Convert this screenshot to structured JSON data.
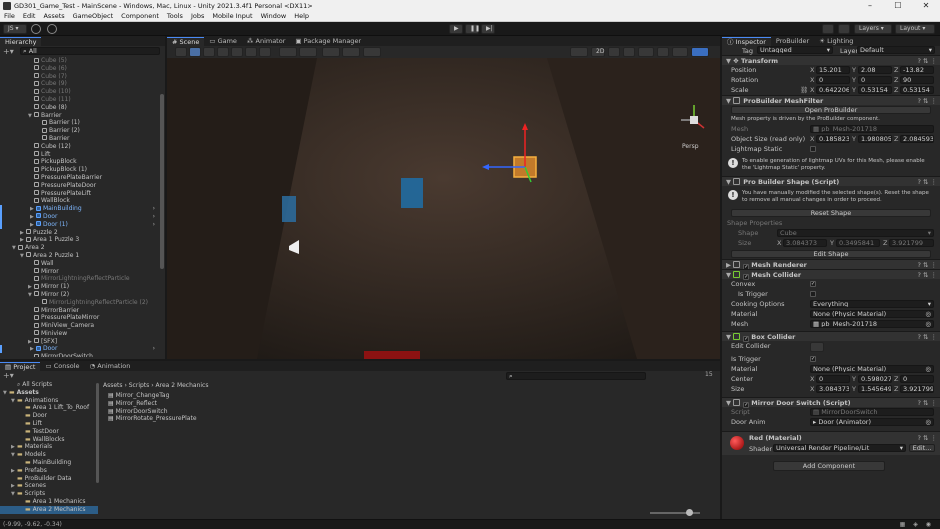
{
  "window": {
    "title": "GD301_Game_Test - MainScene - Windows, Mac, Linux - Unity 2021.3.4f1 Personal <DX11>"
  },
  "menu": [
    "File",
    "Edit",
    "Assets",
    "GameObject",
    "Component",
    "Tools",
    "Jobs",
    "Mobile Input",
    "Window",
    "Help"
  ],
  "toolbar": {
    "account": "JS",
    "layers": "Layers",
    "layout": "Layout"
  },
  "hierarchy": {
    "tab": "Hierarchy",
    "search_placeholder": "All",
    "rows": [
      {
        "label": "Cube (5)",
        "indent": 3,
        "dim": true
      },
      {
        "label": "Cube (6)",
        "indent": 3,
        "dim": true
      },
      {
        "label": "Cube (7)",
        "indent": 3,
        "dim": true
      },
      {
        "label": "Cube (9)",
        "indent": 3,
        "dim": true
      },
      {
        "label": "Cube (10)",
        "indent": 3,
        "dim": true
      },
      {
        "label": "Cube (11)",
        "indent": 3,
        "dim": true
      },
      {
        "label": "Cube (8)",
        "indent": 3
      },
      {
        "label": "Barrier",
        "indent": 3,
        "arrow": "▼"
      },
      {
        "label": "Barrier (1)",
        "indent": 4
      },
      {
        "label": "Barrier (2)",
        "indent": 4
      },
      {
        "label": "Barrier",
        "indent": 4
      },
      {
        "label": "Cube (12)",
        "indent": 3
      },
      {
        "label": "Lift",
        "indent": 3
      },
      {
        "label": "PickupBlock",
        "indent": 3
      },
      {
        "label": "PickupBlock (1)",
        "indent": 3
      },
      {
        "label": "PressurePlateBarrier",
        "indent": 3
      },
      {
        "label": "PressurePlateDoor",
        "indent": 3
      },
      {
        "label": "PressurePlateLift",
        "indent": 3
      },
      {
        "label": "WallBlock",
        "indent": 3
      },
      {
        "label": "MainBuilding",
        "indent": 3,
        "arrow": "▶",
        "blue": true
      },
      {
        "label": "Door",
        "indent": 3,
        "arrow": "▶",
        "blue": true
      },
      {
        "label": "Door (1)",
        "indent": 3,
        "arrow": "▶",
        "blue": true
      },
      {
        "label": "Puzzle 2",
        "indent": 2,
        "arrow": "▶"
      },
      {
        "label": "Area 1 Puzzle 3",
        "indent": 2,
        "arrow": "▶"
      },
      {
        "label": "Area 2",
        "indent": 1,
        "arrow": "▼"
      },
      {
        "label": "Area 2 Puzzle 1",
        "indent": 2,
        "arrow": "▼"
      },
      {
        "label": "Wall",
        "indent": 3
      },
      {
        "label": "Mirror",
        "indent": 3
      },
      {
        "label": "MirrorLightningReflectParticle",
        "indent": 3,
        "dim": true
      },
      {
        "label": "Mirror (1)",
        "indent": 3,
        "arrow": "▶"
      },
      {
        "label": "Mirror (2)",
        "indent": 3,
        "arrow": "▼"
      },
      {
        "label": "MirrorLightningReflectParticle (2)",
        "indent": 4,
        "dim": true
      },
      {
        "label": "MirrorBarrier",
        "indent": 3
      },
      {
        "label": "PressurePlateMirror",
        "indent": 3
      },
      {
        "label": "MiniView_Camera",
        "indent": 3
      },
      {
        "label": "Miniview",
        "indent": 3
      },
      {
        "label": "[SFX]",
        "indent": 3,
        "arrow": "▶"
      },
      {
        "label": "Door",
        "indent": 3,
        "arrow": "▶",
        "blue": true
      },
      {
        "label": "MirrorDoorSwitch",
        "indent": 3
      }
    ]
  },
  "scene": {
    "tabs": [
      "Scene",
      "Game",
      "Animator",
      "Package Manager"
    ],
    "mode_2d": "2D",
    "persp": "Persp"
  },
  "project": {
    "tabs": [
      "Project",
      "Console",
      "Animation"
    ],
    "tree": [
      {
        "label": "All Scripts",
        "indent": 1
      },
      {
        "label": "Assets",
        "indent": 0,
        "arrow": "▼",
        "bold": true
      },
      {
        "label": "Animations",
        "indent": 1,
        "arrow": "▼"
      },
      {
        "label": "Area 1 Lift_To_Roof",
        "indent": 2
      },
      {
        "label": "Door",
        "indent": 2
      },
      {
        "label": "Lift",
        "indent": 2
      },
      {
        "label": "TestDoor",
        "indent": 2
      },
      {
        "label": "WallBlocks",
        "indent": 2
      },
      {
        "label": "Materials",
        "indent": 1,
        "arrow": "▶"
      },
      {
        "label": "Models",
        "indent": 1,
        "arrow": "▼"
      },
      {
        "label": "MainBuilding",
        "indent": 2
      },
      {
        "label": "Prefabs",
        "indent": 1,
        "arrow": "▶"
      },
      {
        "label": "ProBuilder Data",
        "indent": 1
      },
      {
        "label": "Scenes",
        "indent": 1,
        "arrow": "▶"
      },
      {
        "label": "Scripts",
        "indent": 1,
        "arrow": "▼"
      },
      {
        "label": "Area 1 Mechanics",
        "indent": 2
      },
      {
        "label": "Area 2 Mechanics",
        "indent": 2,
        "selected": true
      }
    ],
    "breadcrumb": [
      "Assets",
      "Scripts",
      "Area 2 Mechanics"
    ],
    "files": [
      "Mirror_ChangeTag",
      "Mirror_Reflect",
      "MirrorDoorSwitch",
      "MirrorRotate_PressurePlate"
    ],
    "count": "15"
  },
  "inspector": {
    "tabs": [
      "Inspector",
      "ProBuilder",
      "Lighting"
    ],
    "tag_label": "Tag",
    "tag_value": "Untagged",
    "layer_label": "Layer",
    "layer_value": "Default",
    "transform": {
      "title": "Transform",
      "position_label": "Position",
      "rotation_label": "Rotation",
      "scale_label": "Scale",
      "position": [
        "15.201",
        "2.08",
        "-13.82"
      ],
      "rotation": [
        "0",
        "0",
        "90"
      ],
      "scale": [
        "0.642206",
        "0.53154",
        "0.53154"
      ]
    },
    "meshfilter": {
      "title": "ProBuilder MeshFilter",
      "open_button": "Open ProBuilder",
      "note": "Mesh property is driven by the ProBuilder component.",
      "mesh_label": "Mesh",
      "mesh_value": "pb_Mesh-201718",
      "objsize_label": "Object Size (read only)",
      "objsize": [
        "0.1858238",
        "1.980805",
        "2.084593"
      ],
      "lightmap_label": "Lightmap Static",
      "lightmap_help": "To enable generation of lightmap UVs for this Mesh, please enable the 'Lightmap Static' property."
    },
    "shape": {
      "title": "Pro Builder Shape (Script)",
      "help": "You have manually modified the selected shape(s). Reset the shape to remove all manual changes in order to proceed.",
      "reset_button": "Reset Shape",
      "props_label": "Shape Properties",
      "shape_label": "Shape",
      "shape_value": "Cube",
      "size_label": "Size",
      "size": [
        "3.084373",
        "0.3495841",
        "3.921799"
      ],
      "edit_button": "Edit Shape"
    },
    "renderer": {
      "title": "Mesh Renderer"
    },
    "collider": {
      "title": "Mesh Collider",
      "convex_label": "Convex",
      "trigger_label": "Is Trigger",
      "cooking_label": "Cooking Options",
      "cooking_value": "Everything",
      "material_label": "Material",
      "material_value": "None (Physic Material)",
      "mesh_label": "Mesh",
      "mesh_value": "pb_Mesh-201718"
    },
    "box": {
      "title": "Box Collider",
      "edit_label": "Edit Collider",
      "trigger_label": "Is Trigger",
      "material_label": "Material",
      "material_value": "None (Physic Material)",
      "center_label": "Center",
      "center": [
        "0",
        "0.5980272",
        "0"
      ],
      "size_label": "Size",
      "size": [
        "3.084373",
        "1.545649",
        "3.921799"
      ]
    },
    "switch": {
      "title": "Mirror Door Switch (Script)",
      "script_label": "Script",
      "script_value": "MirrorDoorSwitch",
      "anim_label": "Door Anim",
      "anim_value": "Door (Animator)"
    },
    "material": {
      "title": "Red (Material)",
      "shader_label": "Shader",
      "shader_value": "Universal Render Pipeline/Lit",
      "edit_button": "Edit..."
    },
    "add_component": "Add Component"
  },
  "status": {
    "coords": "(-9.99, -9.62, -0.34)"
  }
}
